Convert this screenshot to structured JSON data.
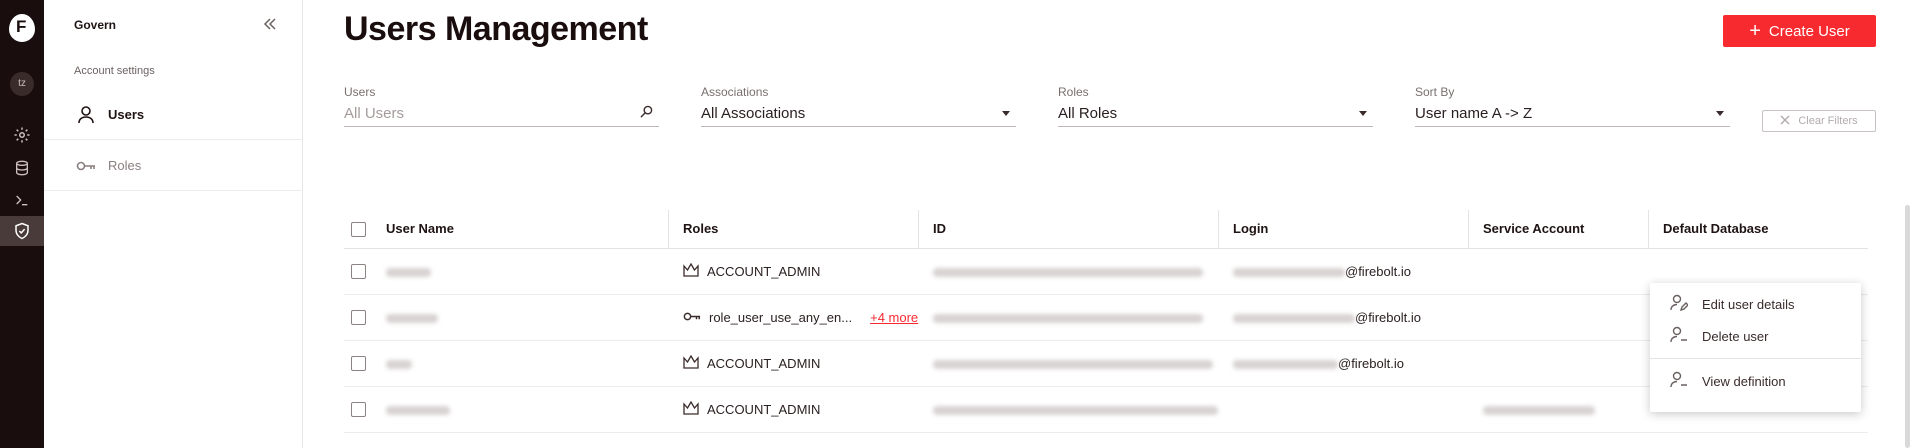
{
  "rail": {
    "avatar_initials": "tz"
  },
  "sidebar": {
    "title": "Govern",
    "section": "Account settings",
    "items": [
      {
        "label": "Users",
        "active": true
      },
      {
        "label": "Roles",
        "active": false
      }
    ]
  },
  "header": {
    "title": "Users Management",
    "create_label": "Create User"
  },
  "filters": {
    "users": {
      "label": "Users",
      "placeholder": "All Users"
    },
    "associations": {
      "label": "Associations",
      "value": "All Associations"
    },
    "roles": {
      "label": "Roles",
      "value": "All Roles"
    },
    "sort": {
      "label": "Sort By",
      "value": "User name A -> Z"
    },
    "clear_label": "Clear Filters"
  },
  "table": {
    "columns": [
      "User Name",
      "Roles",
      "ID",
      "Login",
      "Service Account",
      "Default Database"
    ],
    "rows": [
      {
        "role": "ACCOUNT_ADMIN",
        "role_icon": "crown-icon",
        "login_domain": "@firebolt.io",
        "more": ""
      },
      {
        "role": "role_user_use_any_en...",
        "role_icon": "key-icon",
        "login_domain": "@firebolt.io",
        "more": "+4 more"
      },
      {
        "role": "ACCOUNT_ADMIN",
        "role_icon": "crown-icon",
        "login_domain": "@firebolt.io",
        "more": ""
      },
      {
        "role": "ACCOUNT_ADMIN",
        "role_icon": "crown-icon",
        "login_domain": "",
        "more": ""
      }
    ]
  },
  "context_menu": {
    "items": [
      "Edit user details",
      "Delete user",
      "View definition"
    ]
  },
  "colors": {
    "accent": "#f72a30",
    "rail": "#1a0d0d"
  }
}
